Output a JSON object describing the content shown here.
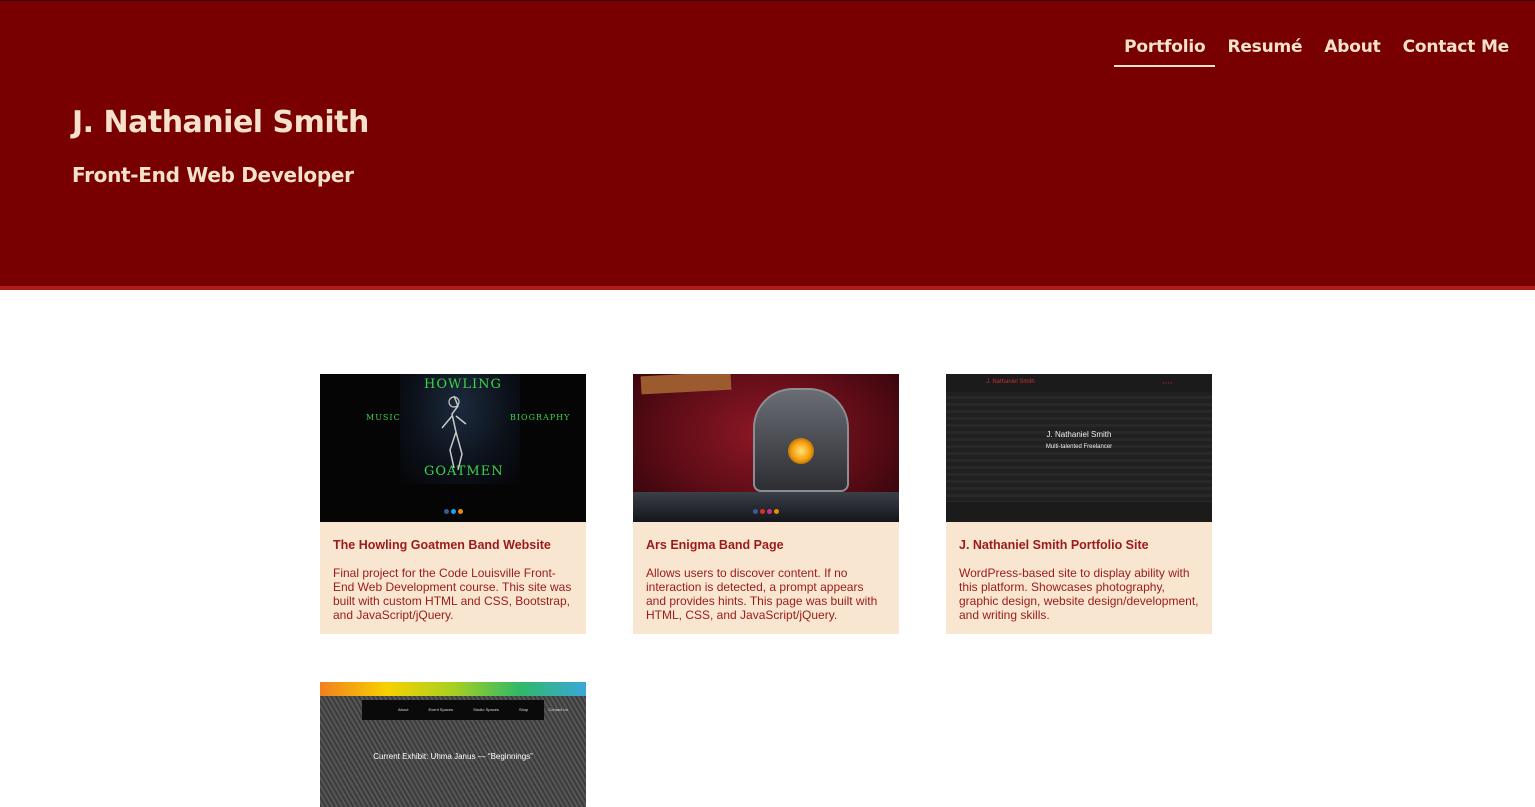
{
  "nav": {
    "items": [
      {
        "label": "Portfolio",
        "active": true
      },
      {
        "label": "Resumé",
        "active": false
      },
      {
        "label": "About",
        "active": false
      },
      {
        "label": "Contact Me",
        "active": false
      }
    ]
  },
  "hero": {
    "title": "J. Nathaniel Smith",
    "subtitle": "Front-End Web Developer"
  },
  "colors": {
    "header_bg": "#780000",
    "header_stripe": "#b01c1c",
    "header_text": "#f6e2cc",
    "card_bg": "#f8e6d0",
    "card_text": "#9c1a1a"
  },
  "projects": [
    {
      "title": "The Howling Goatmen Band Website",
      "description": "Final project for the Code Louisville Front-End Web Development course. This site was built with custom HTML and CSS, Bootstrap, and JavaScript/jQuery.",
      "thumb": {
        "heading_top": "HOWLING",
        "heading_bottom": "GOATMEN",
        "left_link": "MUSIC",
        "right_link": "BIOGRAPHY"
      }
    },
    {
      "title": "Ars Enigma Band Page",
      "description": "Allows users to discover content. If no interaction is detected, a prompt appears and provides hints. This page was built with HTML, CSS, and JavaScript/jQuery."
    },
    {
      "title": "J. Nathaniel Smith Portfolio Site",
      "description": "WordPress-based site to display ability with this platform. Showcases photography, graphic design, website design/development, and writing skills.",
      "thumb": {
        "brand": "J. Nathaniel Smith",
        "name": "J. Nathaniel Smith",
        "tagline": "Multi-talented Freelancer"
      }
    },
    {
      "title": "",
      "description": "",
      "thumb": {
        "nav_links": [
          "About",
          "Event Spaces",
          "Studio Spaces",
          "Shop",
          "Contact Us"
        ],
        "headline": "Current Exhibit: Uhma Janus — “Beginnings”"
      }
    }
  ]
}
